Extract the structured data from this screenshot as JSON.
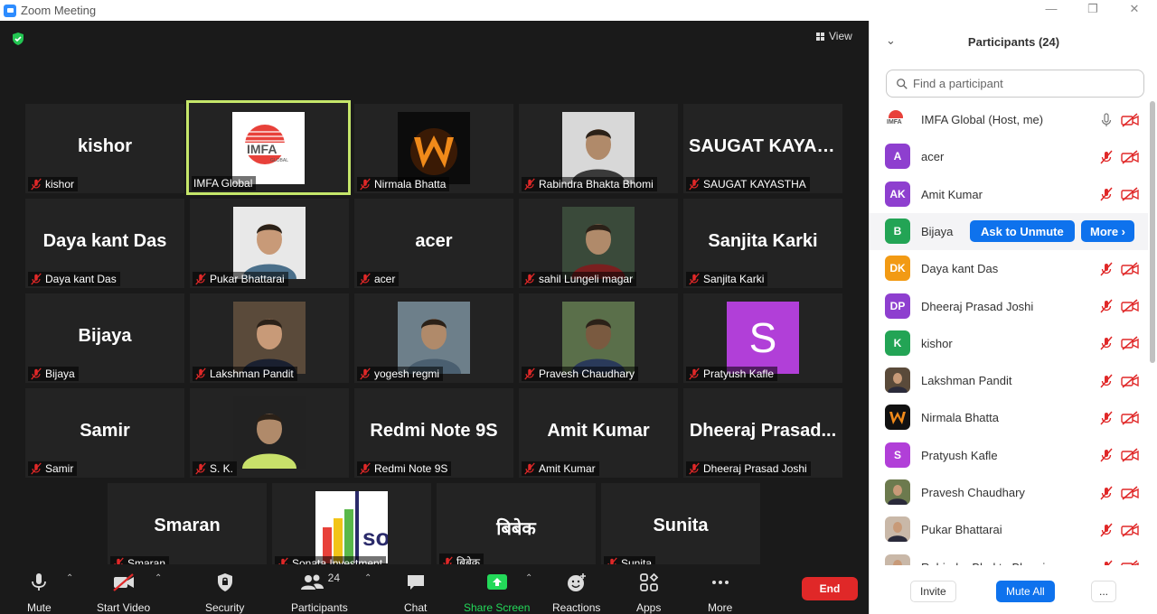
{
  "window": {
    "title": "Zoom Meeting"
  },
  "video": {
    "view_label": "View"
  },
  "tiles": [
    {
      "id": "kishor",
      "big": "kishor",
      "label": "kishor"
    },
    {
      "id": "imfa",
      "big": "",
      "label": "IMFA Global"
    },
    {
      "id": "nirmala",
      "big": "",
      "label": "Nirmala Bhatta"
    },
    {
      "id": "rabindra",
      "big": "",
      "label": "Rabindra Bhakta Bhomi"
    },
    {
      "id": "saugat",
      "big": "SAUGAT  KAYAS...",
      "label": "SAUGAT KAYASTHA"
    },
    {
      "id": "daya",
      "big": "Daya kant Das",
      "label": "Daya kant Das"
    },
    {
      "id": "pukar",
      "big": "",
      "label": "Pukar Bhattarai"
    },
    {
      "id": "acer",
      "big": "acer",
      "label": "acer"
    },
    {
      "id": "sahil",
      "big": "",
      "label": "sahil Lungeli  magar"
    },
    {
      "id": "sanjita",
      "big": "Sanjita Karki",
      "label": "Sanjita Karki"
    },
    {
      "id": "bijaya",
      "big": "Bijaya",
      "label": "Bijaya"
    },
    {
      "id": "lakshman",
      "big": "",
      "label": "Lakshman Pandit"
    },
    {
      "id": "yogesh",
      "big": "",
      "label": "yogesh regmi"
    },
    {
      "id": "pravesh",
      "big": "",
      "label": "Pravesh Chaudhary"
    },
    {
      "id": "pratyush",
      "big": "",
      "label": "Pratyush Kafle",
      "avatar_letter": "S"
    },
    {
      "id": "samir",
      "big": "Samir",
      "label": "Samir"
    },
    {
      "id": "sk",
      "big": "",
      "label": "S. K."
    },
    {
      "id": "redmi",
      "big": "Redmi Note 9S",
      "label": "Redmi Note 9S"
    },
    {
      "id": "amit",
      "big": "Amit Kumar",
      "label": "Amit Kumar"
    },
    {
      "id": "dheeraj",
      "big": "Dheeraj  Prasad...",
      "label": "Dheeraj Prasad Joshi"
    },
    {
      "id": "smaran",
      "big": "Smaran",
      "label": "Smaran"
    },
    {
      "id": "sonata",
      "big": "",
      "label": "Sonata Investment"
    },
    {
      "id": "bibek",
      "big": "बिबेक",
      "label": "बिबेक"
    },
    {
      "id": "sunita",
      "big": "Sunita",
      "label": "Sunita"
    }
  ],
  "toolbar": {
    "mute": "Mute",
    "start_video": "Start Video",
    "security": "Security",
    "participants": "Participants",
    "participants_count": "24",
    "chat": "Chat",
    "share_screen": "Share Screen",
    "reactions": "Reactions",
    "apps": "Apps",
    "more": "More",
    "end": "End"
  },
  "panel": {
    "title": "Participants (24)",
    "search_placeholder": "Find a participant",
    "ask_to_unmute": "Ask to Unmute",
    "more": "More ›",
    "invite": "Invite",
    "mute_all": "Mute All",
    "overflow": "...",
    "participants": [
      {
        "name": "IMFA Global (Host, me)",
        "initials": "IMFA",
        "color": "#ffffff",
        "avatar": "logo"
      },
      {
        "name": "acer",
        "initials": "A",
        "color": "#8e3fcf",
        "avatar": "initials"
      },
      {
        "name": "Amit Kumar",
        "initials": "AK",
        "color": "#8e3fcf",
        "avatar": "initials"
      },
      {
        "name": "Bijaya",
        "initials": "B",
        "color": "#23a455",
        "avatar": "initials"
      },
      {
        "name": "Daya kant Das",
        "initials": "DK",
        "color": "#f29a14",
        "avatar": "initials"
      },
      {
        "name": "Dheeraj Prasad Joshi",
        "initials": "DP",
        "color": "#8e3fcf",
        "avatar": "initials"
      },
      {
        "name": "kishor",
        "initials": "K",
        "color": "#23a455",
        "avatar": "initials"
      },
      {
        "name": "Lakshman Pandit",
        "initials": "",
        "color": "#5a4a3a",
        "avatar": "photo"
      },
      {
        "name": "Nirmala Bhatta",
        "initials": "W",
        "color": "#1a1a1a",
        "avatar": "w-logo"
      },
      {
        "name": "Pratyush Kafle",
        "initials": "S",
        "color": "#b13fd8",
        "avatar": "initials"
      },
      {
        "name": "Pravesh Chaudhary",
        "initials": "",
        "color": "#6c7a4e",
        "avatar": "photo"
      },
      {
        "name": "Pukar Bhattarai",
        "initials": "",
        "color": "#c9b8a8",
        "avatar": "photo"
      },
      {
        "name": "Rabindra Bhakta Bhomi",
        "initials": "",
        "color": "#c9b8a8",
        "avatar": "photo"
      }
    ]
  },
  "colors": {
    "accent": "#0e72ed",
    "muted": "#e02828",
    "active_speaker": "#c5e66a",
    "share_green": "#23d959"
  }
}
